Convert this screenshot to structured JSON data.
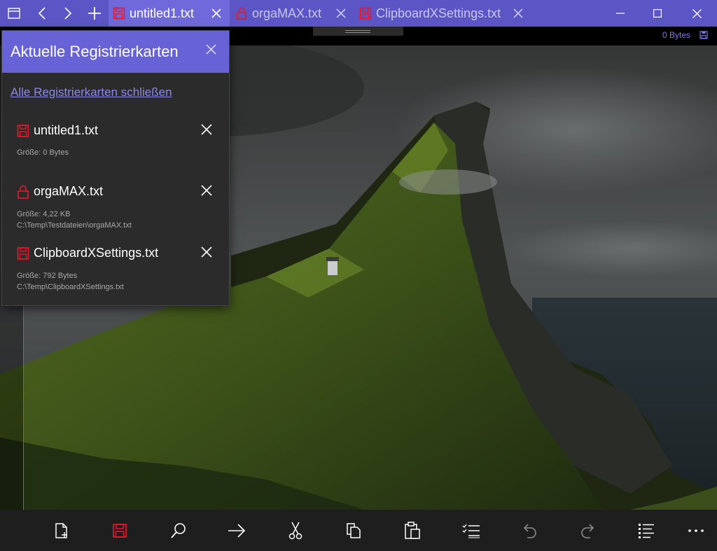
{
  "tabs": [
    {
      "label": "untitled1.txt",
      "icon": "save-icon",
      "active": true
    },
    {
      "label": "orgaMAX.txt",
      "icon": "lock-icon",
      "active": false
    },
    {
      "label": "ClipboardXSettings.txt",
      "icon": "save-icon",
      "active": false
    }
  ],
  "status": {
    "size": "0 Bytes"
  },
  "panel": {
    "title": "Aktuelle Registrierkarten",
    "close_all": "Alle Registrierkarten schließen",
    "items": [
      {
        "name": "untitled1.txt",
        "icon": "save-icon",
        "size": "Größe: 0 Bytes",
        "path": ""
      },
      {
        "name": "orgaMAX.txt",
        "icon": "lock-icon",
        "size": "Größe: 4,22 KB",
        "path": "C:\\Temp\\Testdateien\\orgaMAX.txt"
      },
      {
        "name": "ClipboardXSettings.txt",
        "icon": "save-icon",
        "size": "Größe: 792 Bytes",
        "path": "C:\\Temp\\ClipboardXSettings.txt"
      }
    ]
  },
  "colors": {
    "accent": "#5b55c6",
    "panel_header": "#6762d6",
    "link": "#8c87ea",
    "icon_red": "#e8172b"
  }
}
